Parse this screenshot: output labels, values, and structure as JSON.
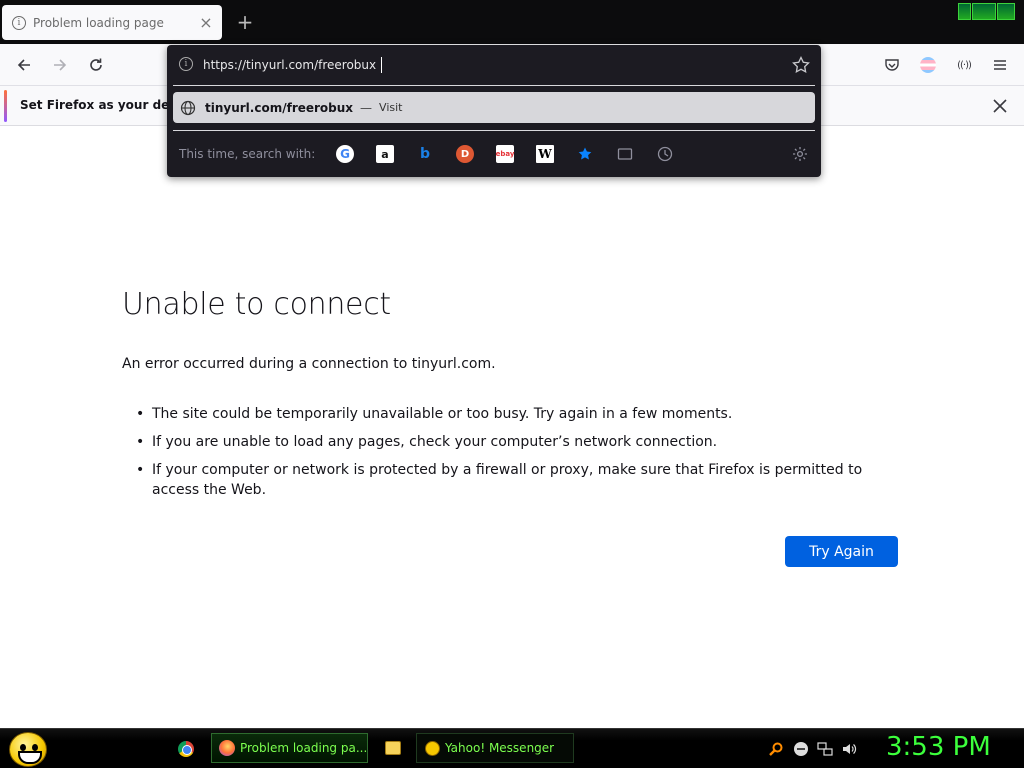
{
  "browser": {
    "tab": {
      "title": "Problem loading page",
      "close_icon": "close-icon"
    },
    "new_tab_icon": "plus-icon",
    "nav": {
      "back_icon": "arrow-left-icon",
      "forward_icon": "arrow-right-icon",
      "reload_icon": "reload-icon",
      "pocket_icon": "pocket-icon",
      "account_icon": "account-avatar-icon",
      "extension_icon": "extension-icon",
      "menu_icon": "hamburger-menu-icon"
    },
    "notification": {
      "text": "Set Firefox as your default",
      "close_icon": "close-icon"
    },
    "urlbar": {
      "value": "https://tinyurl.com/freerobux",
      "result": {
        "url": "tinyurl.com/freerobux",
        "separator": "—",
        "action": "Visit"
      },
      "search_with_label": "This time, search with:",
      "engines": [
        {
          "name": "Google",
          "icon": "google-icon",
          "glyph": "G"
        },
        {
          "name": "Amazon",
          "icon": "amazon-icon",
          "glyph": "a"
        },
        {
          "name": "Bing",
          "icon": "bing-icon",
          "glyph": "b"
        },
        {
          "name": "DuckDuckGo",
          "icon": "duckduckgo-icon",
          "glyph": "D"
        },
        {
          "name": "eBay",
          "icon": "ebay-icon",
          "glyph": "ebay"
        },
        {
          "name": "Wikipedia",
          "icon": "wikipedia-icon",
          "glyph": "W"
        }
      ],
      "modes": [
        "bookmarks-star-icon",
        "tabs-icon",
        "history-clock-icon"
      ],
      "settings_icon": "gear-icon"
    }
  },
  "error_page": {
    "title": "Unable to connect",
    "description": "An error occurred during a connection to tinyurl.com.",
    "bullets": [
      "The site could be temporarily unavailable or too busy. Try again in a few moments.",
      "If you are unable to load any pages, check your computer’s network connection.",
      "If your computer or network is protected by a firewall or proxy, make sure that Firefox is permitted to access the Web."
    ],
    "button": "Try Again"
  },
  "taskbar": {
    "tasks": [
      {
        "label": "Problem loading pa...",
        "icon": "firefox-icon"
      },
      {
        "label": "Yahoo! Messenger",
        "icon": "yahoo-messenger-icon"
      }
    ],
    "clock": "3:53 PM"
  },
  "colors": {
    "accent_blue": "#0061e0",
    "taskbar_text": "#7cff4f",
    "clock_green": "#3cff3c"
  }
}
